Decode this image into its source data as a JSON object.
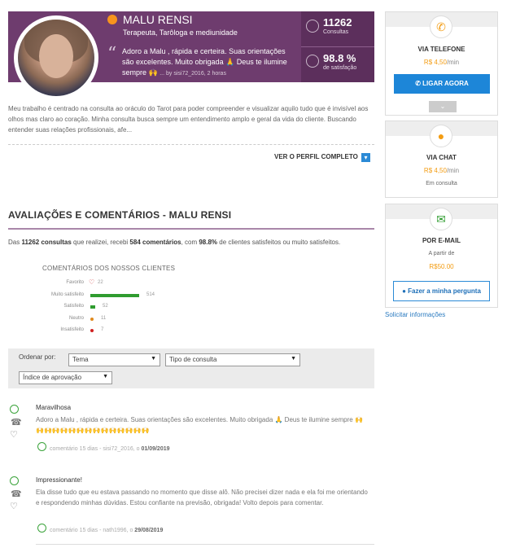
{
  "profile": {
    "name": "MALU RENSI",
    "tags": "Terapeuta, Tarôloga e mediunidade",
    "quote": "Adoro a Malu , rápida e certeira. Suas orientações são excelentes. Muito obrigada 🙏 Deus te ilumine sempre 🙌",
    "quote_by": "... by sisi72_2016, 2 horas",
    "consultas_num": "11262",
    "consultas_label": "Consultas",
    "satisfacao_num": "98.8 %",
    "satisfacao_label": "de satisfação",
    "status_color": "#f7941d"
  },
  "bio": "Meu trabalho é centrado na consulta ao oráculo do Tarot para poder compreender e visualizar aquilo tudo que é invisível aos olhos mas claro ao coração. Minha consulta busca sempre um entendimento amplo e geral da vida do cliente. Buscando entender suas relações profissionais, afe...",
  "ver_perfil": "VER O PERFIL COMPLETO",
  "reviews_section": {
    "title": "AVALIAÇÕES E COMENTÁRIOS - MALU RENSI",
    "summary_pre": "Das ",
    "summary_consultas": "11262 consultas",
    "summary_mid1": " que realizei, recebi ",
    "summary_comentarios": "584 comentários",
    "summary_mid2": ", com ",
    "summary_pct": "98.8%",
    "summary_post": " de clientes satisfeitos ou muito satisfeitos."
  },
  "chart_data": {
    "type": "bar",
    "title": "COMENTÁRIOS DOS NOSSOS CLIENTES",
    "categories": [
      "Favorito",
      "Muito satisfeito",
      "Satisfeito",
      "Neutro",
      "Insatisfeito"
    ],
    "values": [
      22,
      514,
      52,
      11,
      7
    ],
    "colors": [
      "#d04040",
      "#2f9c2f",
      "#2f9c2f",
      "#e08a1e",
      "#d02020"
    ]
  },
  "filter": {
    "label": "Ordenar por:",
    "tema": "Tema",
    "tipo": "Tipo de consulta",
    "indice": "Índice de aprovação"
  },
  "reviews": [
    {
      "title": "Maravilhosa",
      "text": "Adoro a Malu , rápida e certeira. Suas orientações são excelentes. Muito obrigada 🙏 Deus te ilumine sempre 🙌🙌🙌🙌🙌🙌🙌🙌🙌🙌🙌🙌🙌🙌🙌",
      "meta": "comentário 15 dias - sisi72_2016, o ",
      "date": "01/09/2019"
    },
    {
      "title": "Impressionante!",
      "text": "Ela disse tudo que eu estava passando no momento que disse alô. Não precisei dizer nada e ela foi me orientando e respondendo minhas dúvidas. Estou confiante na previsão, obrigada! Volto depois para comentar.",
      "meta": "comentário 15 dias - nath1996, o ",
      "date": "29/08/2019"
    }
  ],
  "sidebar": {
    "phone": {
      "title": "VIA TELEFONE",
      "price": "R$ 4,50",
      "unit": "/min",
      "button": "LIGAR AGORA"
    },
    "chat": {
      "title": "VIA CHAT",
      "price": "R$ 4,50",
      "unit": "/min",
      "note": "Em consulta"
    },
    "email": {
      "title": "POR E-MAIL",
      "note": "A partir de",
      "price": "R$50.00",
      "button": "Fazer a minha pergunta"
    },
    "solicitar": "Solicitar informações",
    "accent": "#f39c12",
    "button_color": "#1d86d8"
  }
}
